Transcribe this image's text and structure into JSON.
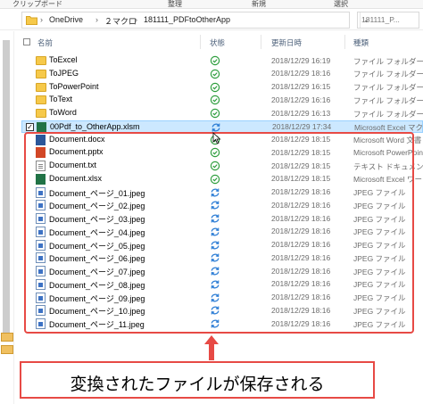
{
  "ribbon": {
    "groups": [
      "クリップボード",
      "整理",
      "新規",
      "選択"
    ]
  },
  "address": {
    "segments": [
      "OneDrive",
      "２マクロ",
      "181111_PDFtoOtherApp"
    ],
    "search_placeholder": "181111_P..."
  },
  "columns": {
    "name": "名前",
    "status": "状態",
    "date": "更新日時",
    "type": "種類"
  },
  "rows": [
    {
      "name": "ToExcel",
      "icon": "folder-icon",
      "status": "synced",
      "date": "2018/12/29 16:19",
      "type": "ファイル フォルダー"
    },
    {
      "name": "ToJPEG",
      "icon": "folder-icon",
      "status": "synced",
      "date": "2018/12/29 18:16",
      "type": "ファイル フォルダー"
    },
    {
      "name": "ToPowerPoint",
      "icon": "folder-icon",
      "status": "synced",
      "date": "2018/12/29 16:15",
      "type": "ファイル フォルダー"
    },
    {
      "name": "ToText",
      "icon": "folder-icon",
      "status": "synced",
      "date": "2018/12/29 16:16",
      "type": "ファイル フォルダー"
    },
    {
      "name": "ToWord",
      "icon": "folder-icon",
      "status": "synced",
      "date": "2018/12/29 16:13",
      "type": "ファイル フォルダー"
    },
    {
      "name": "00Pdf_to_OtherApp.xlsm",
      "icon": "excel-macro-icon",
      "status": "syncing",
      "date": "2018/12/29 17:34",
      "type": "Microsoft Excel マクロ",
      "checked": true,
      "selected": true
    },
    {
      "name": "Document.docx",
      "icon": "word-icon",
      "status": "synced",
      "date": "2018/12/29 18:15",
      "type": "Microsoft Word 文書"
    },
    {
      "name": "Document.pptx",
      "icon": "powerpoint-icon",
      "status": "synced",
      "date": "2018/12/29 18:15",
      "type": "Microsoft PowerPoint"
    },
    {
      "name": "Document.txt",
      "icon": "text-file-icon",
      "status": "synced",
      "date": "2018/12/29 18:15",
      "type": "テキスト ドキュメント"
    },
    {
      "name": "Document.xlsx",
      "icon": "excel-icon",
      "status": "synced",
      "date": "2018/12/29 18:15",
      "type": "Microsoft Excel ワーク"
    },
    {
      "name": "Document_ページ_01.jpeg",
      "icon": "jpeg-icon",
      "status": "syncing",
      "date": "2018/12/29 18:16",
      "type": "JPEG ファイル"
    },
    {
      "name": "Document_ページ_02.jpeg",
      "icon": "jpeg-icon",
      "status": "syncing",
      "date": "2018/12/29 18:16",
      "type": "JPEG ファイル"
    },
    {
      "name": "Document_ページ_03.jpeg",
      "icon": "jpeg-icon",
      "status": "syncing",
      "date": "2018/12/29 18:16",
      "type": "JPEG ファイル"
    },
    {
      "name": "Document_ページ_04.jpeg",
      "icon": "jpeg-icon",
      "status": "syncing",
      "date": "2018/12/29 18:16",
      "type": "JPEG ファイル"
    },
    {
      "name": "Document_ページ_05.jpeg",
      "icon": "jpeg-icon",
      "status": "syncing",
      "date": "2018/12/29 18:16",
      "type": "JPEG ファイル"
    },
    {
      "name": "Document_ページ_06.jpeg",
      "icon": "jpeg-icon",
      "status": "syncing",
      "date": "2018/12/29 18:16",
      "type": "JPEG ファイル"
    },
    {
      "name": "Document_ページ_07.jpeg",
      "icon": "jpeg-icon",
      "status": "syncing",
      "date": "2018/12/29 18:16",
      "type": "JPEG ファイル"
    },
    {
      "name": "Document_ページ_08.jpeg",
      "icon": "jpeg-icon",
      "status": "syncing",
      "date": "2018/12/29 18:16",
      "type": "JPEG ファイル"
    },
    {
      "name": "Document_ページ_09.jpeg",
      "icon": "jpeg-icon",
      "status": "syncing",
      "date": "2018/12/29 18:16",
      "type": "JPEG ファイル"
    },
    {
      "name": "Document_ページ_10.jpeg",
      "icon": "jpeg-icon",
      "status": "syncing",
      "date": "2018/12/29 18:16",
      "type": "JPEG ファイル"
    },
    {
      "name": "Document_ページ_11.jpeg",
      "icon": "jpeg-icon",
      "status": "syncing",
      "date": "2018/12/29 18:16",
      "type": "JPEG ファイル"
    }
  ],
  "callout": {
    "text": "変換されたファイルが保存される"
  },
  "colors": {
    "highlight": "#e74a45",
    "synced": "#2e9e3e",
    "syncing": "#2f7fd6",
    "selection": "#cce8ff"
  }
}
